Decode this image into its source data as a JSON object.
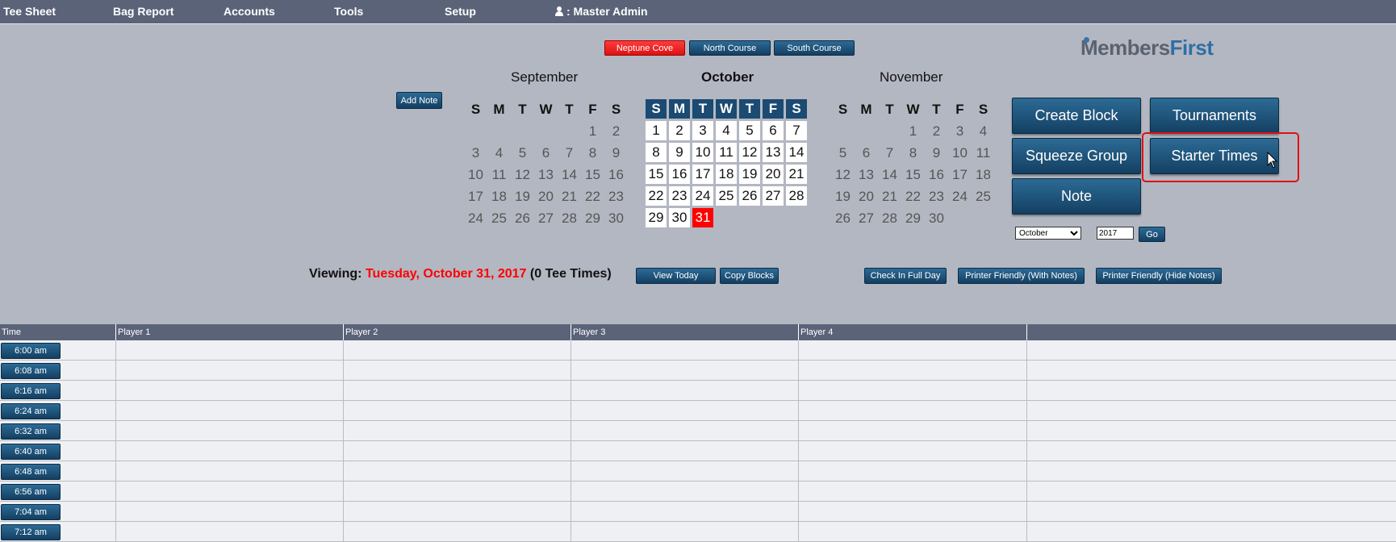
{
  "nav": {
    "tee_sheet": "Tee Sheet",
    "bag_report": "Bag Report",
    "accounts": "Accounts",
    "tools": "Tools",
    "setup": "Setup",
    "user": ": Master Admin"
  },
  "courses": [
    "Neptune Cove",
    "North Course",
    "South Course"
  ],
  "logo": {
    "part1": "Members",
    "part2": "First"
  },
  "add_note": "Add Note",
  "calendars": {
    "prev": {
      "title": "September",
      "days": [
        "S",
        "M",
        "T",
        "W",
        "T",
        "F",
        "S"
      ],
      "rows": [
        [
          "",
          "",
          "",
          "",
          "",
          "1",
          "2"
        ],
        [
          "3",
          "4",
          "5",
          "6",
          "7",
          "8",
          "9"
        ],
        [
          "10",
          "11",
          "12",
          "13",
          "14",
          "15",
          "16"
        ],
        [
          "17",
          "18",
          "19",
          "20",
          "21",
          "22",
          "23"
        ],
        [
          "24",
          "25",
          "26",
          "27",
          "28",
          "29",
          "30"
        ]
      ]
    },
    "current": {
      "title": "October",
      "days": [
        "S",
        "M",
        "T",
        "W",
        "T",
        "F",
        "S"
      ],
      "rows": [
        [
          "1",
          "2",
          "3",
          "4",
          "5",
          "6",
          "7"
        ],
        [
          "8",
          "9",
          "10",
          "11",
          "12",
          "13",
          "14"
        ],
        [
          "15",
          "16",
          "17",
          "18",
          "19",
          "20",
          "21"
        ],
        [
          "22",
          "23",
          "24",
          "25",
          "26",
          "27",
          "28"
        ],
        [
          "29",
          "30",
          "31",
          "",
          "",
          "",
          ""
        ]
      ],
      "selected": "31"
    },
    "next": {
      "title": "November",
      "days": [
        "S",
        "M",
        "T",
        "W",
        "T",
        "F",
        "S"
      ],
      "rows": [
        [
          "",
          "",
          "",
          "1",
          "2",
          "3",
          "4"
        ],
        [
          "5",
          "6",
          "7",
          "8",
          "9",
          "10",
          "11"
        ],
        [
          "12",
          "13",
          "14",
          "15",
          "16",
          "17",
          "18"
        ],
        [
          "19",
          "20",
          "21",
          "22",
          "23",
          "24",
          "25"
        ],
        [
          "26",
          "27",
          "28",
          "29",
          "30",
          "",
          ""
        ]
      ]
    }
  },
  "actions": {
    "create_block": "Create Block",
    "tournaments": "Tournaments",
    "squeeze_group": "Squeeze Group",
    "starter_times": "Starter Times",
    "note": "Note"
  },
  "goto": {
    "month": "October",
    "year": "2017",
    "go": "Go"
  },
  "viewing": {
    "label": "Viewing:",
    "date": "Tuesday, October 31, 2017",
    "count": "(0 Tee Times)"
  },
  "toolbar": {
    "view_today": "View Today",
    "copy_blocks": "Copy Blocks",
    "check_in_full_day": "Check In Full Day",
    "printer_with_notes": "Printer Friendly (With Notes)",
    "printer_hide_notes": "Printer Friendly (Hide Notes)"
  },
  "tee_sheet": {
    "columns": [
      "Time",
      "Player 1",
      "Player 2",
      "Player 3",
      "Player 4"
    ],
    "times": [
      "6:00 am",
      "6:08 am",
      "6:16 am",
      "6:24 am",
      "6:32 am",
      "6:40 am",
      "6:48 am",
      "6:56 am",
      "7:04 am",
      "7:12 am"
    ]
  },
  "colors": {
    "nav_bg": "#5b6378",
    "page_bg": "#b3b7c1",
    "button_blue": "#1b4a72",
    "accent_red": "#ff0000"
  }
}
